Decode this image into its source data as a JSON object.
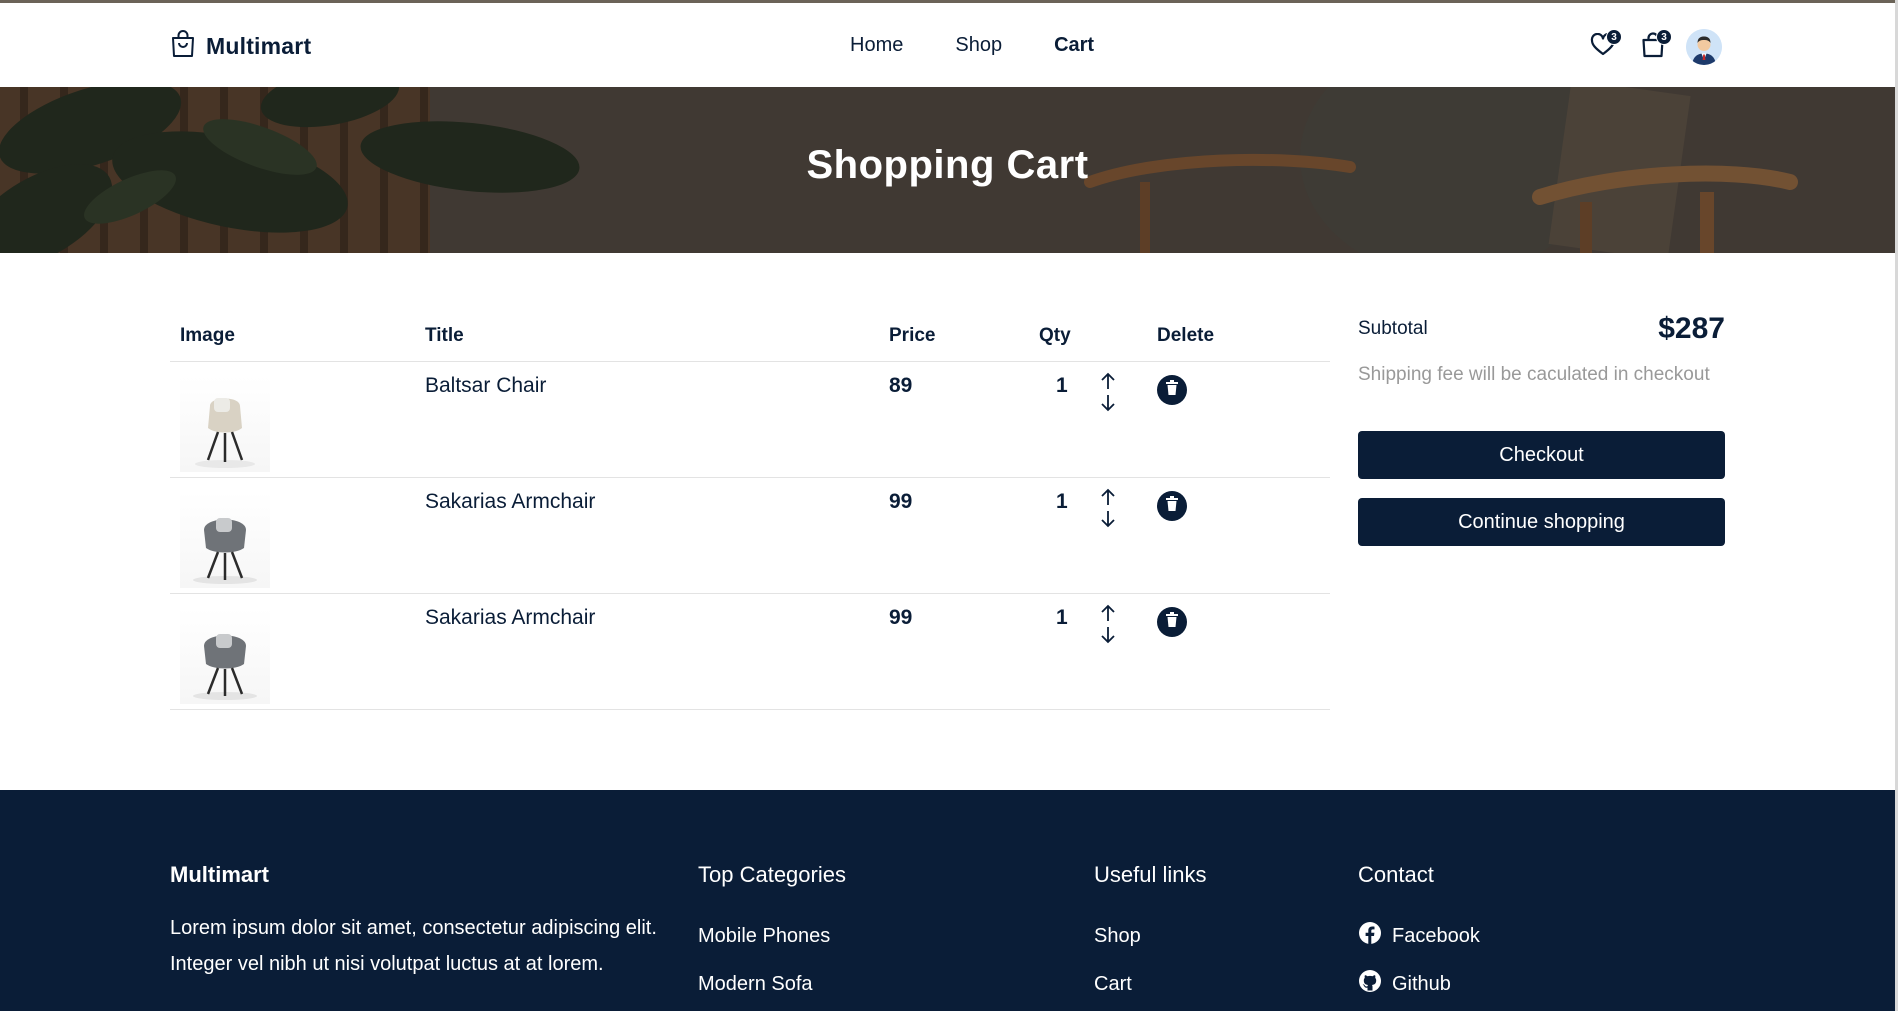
{
  "brand": {
    "name": "Multimart"
  },
  "nav": {
    "items": [
      {
        "label": "Home",
        "active": false
      },
      {
        "label": "Shop",
        "active": false
      },
      {
        "label": "Cart",
        "active": true
      }
    ]
  },
  "header_icons": {
    "wishlist_count": "3",
    "cart_count": "3"
  },
  "hero": {
    "title": "Shopping Cart"
  },
  "table": {
    "headers": [
      "Image",
      "Title",
      "Price",
      "Qty",
      "Delete"
    ],
    "rows": [
      {
        "title": "Baltsar Chair",
        "price": "89",
        "qty": "1",
        "product": "beige chair"
      },
      {
        "title": "Sakarias Armchair",
        "price": "99",
        "qty": "1",
        "product": "grey armchair"
      },
      {
        "title": "Sakarias Armchair",
        "price": "99",
        "qty": "1",
        "product": "grey armchair"
      }
    ]
  },
  "summary": {
    "subtotal_label": "Subtotal",
    "subtotal_value": "$287",
    "shipping_note": "Shipping fee will be caculated in checkout",
    "checkout_label": "Checkout",
    "continue_label": "Continue shopping"
  },
  "footer": {
    "brand": "Multimart",
    "description": "Lorem ipsum dolor sit amet, consectetur adipiscing elit. Integer vel nibh ut nisi volutpat luctus at at lorem.",
    "categories": {
      "title": "Top Categories",
      "items": [
        "Mobile Phones",
        "Modern Sofa"
      ]
    },
    "links": {
      "title": "Useful links",
      "items": [
        "Shop",
        "Cart"
      ]
    },
    "contact": {
      "title": "Contact",
      "items": [
        {
          "label": "Facebook",
          "icon": "facebook-icon"
        },
        {
          "label": "Github",
          "icon": "github-icon"
        }
      ]
    }
  },
  "colors": {
    "primary": "#0a1d37",
    "muted": "#999999",
    "divider": "#e3e3e3"
  }
}
